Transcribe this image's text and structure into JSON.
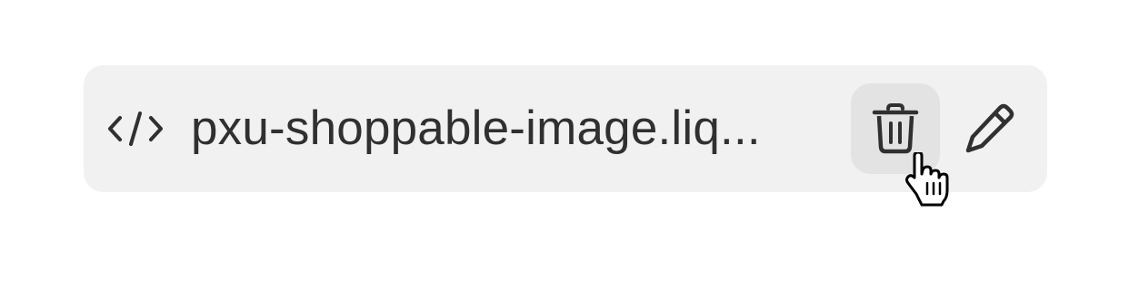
{
  "file_row": {
    "file_icon": "code-icon",
    "file_name": "pxu-shoppable-image.liq...",
    "delete_icon": "trash-icon",
    "edit_icon": "pencil-icon",
    "background_color": "#f1f1f1",
    "hover_color": "#e3e3e3",
    "text_color": "#303030"
  },
  "cursor": {
    "type": "pointer-hand-icon"
  }
}
